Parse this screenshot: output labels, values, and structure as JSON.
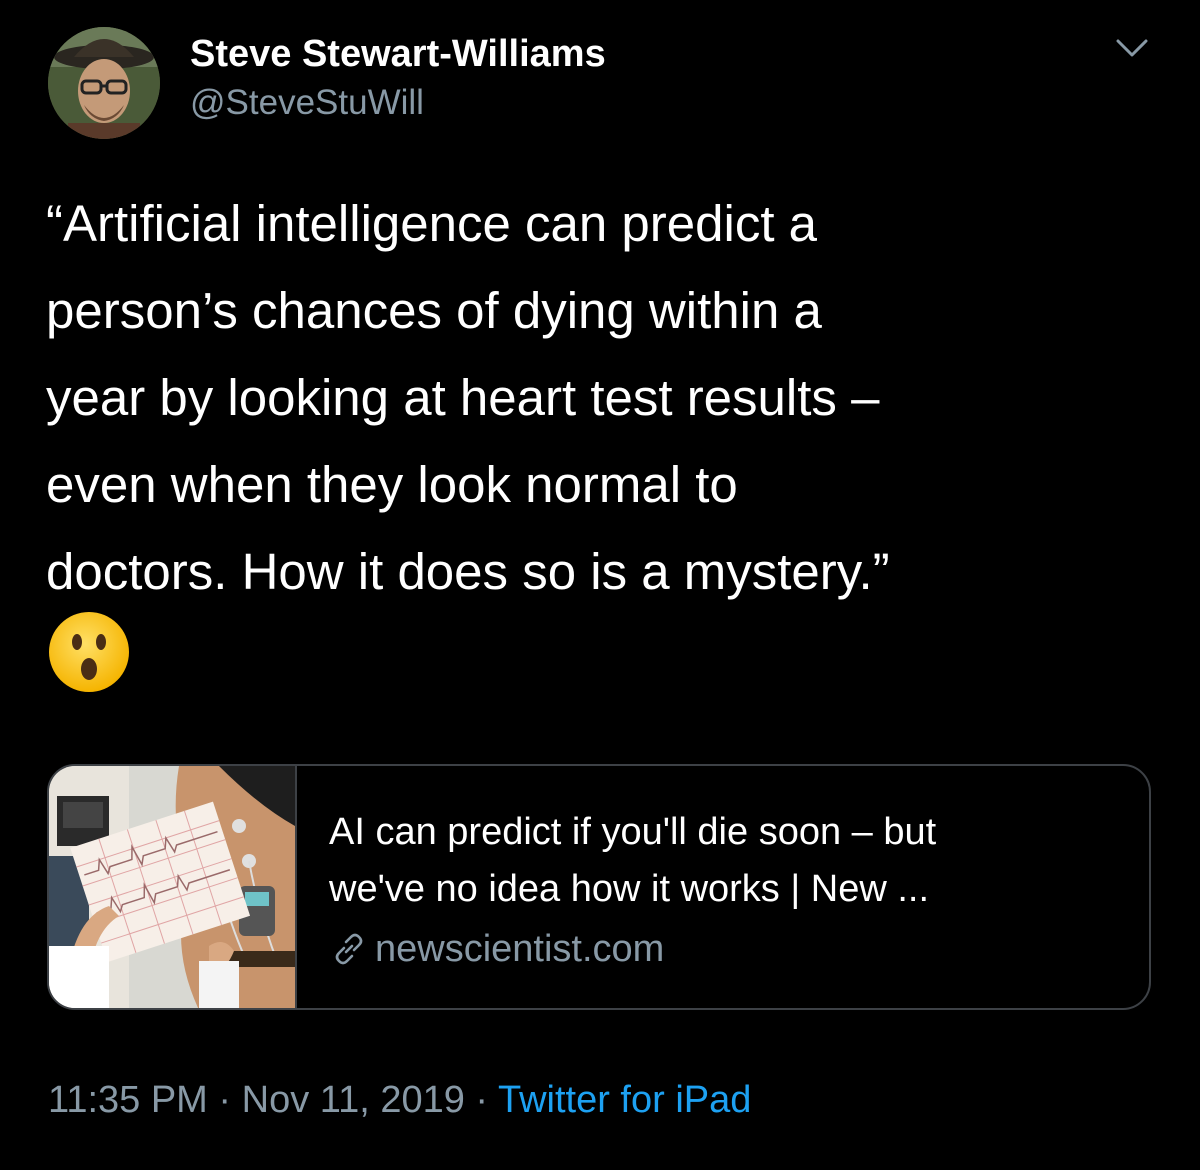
{
  "tweet": {
    "author": {
      "display_name": "Steve Stewart-Williams",
      "handle": "@SteveStuWill",
      "avatar_icon": "profile-photo"
    },
    "text": "“Artificial intelligence can predict a\nperson’s chances of dying within a\nyear by looking at heart test results –\neven when they look normal to\ndoctors. How it does so is a mystery.”",
    "emoji_icon": "hushed-face-emoji",
    "caret_icon": "chevron-down-icon",
    "card": {
      "title_line1": "AI can predict if you'll die soon – but",
      "title_line2": "we've no idea how it works | New ...",
      "domain": "newscientist.com",
      "thumbnail_icon": "ecg-test-photo",
      "link_icon": "link-icon"
    },
    "meta": {
      "time": "11:35 PM",
      "separator": "·",
      "date": "Nov 11, 2019",
      "source": "Twitter for iPad"
    }
  },
  "colors": {
    "background": "#000000",
    "text": "#ffffff",
    "secondary": "#8899a6",
    "link": "#1da1f2",
    "border": "#3d4146"
  }
}
